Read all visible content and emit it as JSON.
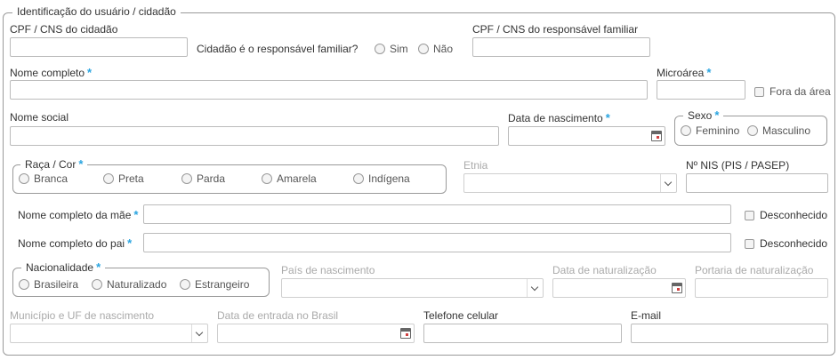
{
  "section": {
    "title": "Identificação do usuário / cidadão"
  },
  "cpf": {
    "label": "CPF / CNS do cidadão",
    "value": ""
  },
  "responsavel": {
    "question": "Cidadão é o responsável familiar?",
    "options": [
      "Sim",
      "Não"
    ]
  },
  "cpf_responsavel": {
    "label": "CPF / CNS do responsável familiar",
    "value": ""
  },
  "nome": {
    "label": "Nome completo",
    "required": "*",
    "value": ""
  },
  "microarea": {
    "label": "Microárea",
    "required": "*",
    "value": "",
    "fora_label": "Fora da área"
  },
  "nome_social": {
    "label": "Nome social",
    "value": ""
  },
  "nascimento": {
    "label": "Data de nascimento",
    "required": "*",
    "value": ""
  },
  "sexo": {
    "legend": "Sexo",
    "required": "*",
    "options": [
      "Feminino",
      "Masculino"
    ]
  },
  "raca": {
    "legend": "Raça / Cor",
    "required": "*",
    "options": [
      "Branca",
      "Preta",
      "Parda",
      "Amarela",
      "Indígena"
    ]
  },
  "etnia": {
    "label": "Etnia",
    "value": ""
  },
  "nis": {
    "label": "Nº NIS (PIS / PASEP)",
    "value": ""
  },
  "mae": {
    "label": "Nome completo da mãe",
    "required": "*",
    "value": "",
    "unknown_label": "Desconhecido"
  },
  "pai": {
    "label": "Nome completo do pai",
    "required": "*",
    "value": "",
    "unknown_label": "Desconhecido"
  },
  "nacionalidade": {
    "legend": "Nacionalidade",
    "required": "*",
    "options": [
      "Brasileira",
      "Naturalizado",
      "Estrangeiro"
    ]
  },
  "pais_nascimento": {
    "label": "País de nascimento",
    "value": ""
  },
  "data_naturalizacao": {
    "label": "Data de naturalização",
    "value": ""
  },
  "portaria": {
    "label": "Portaria de naturalização",
    "value": ""
  },
  "municipio": {
    "label": "Município e UF de nascimento",
    "value": ""
  },
  "data_entrada": {
    "label": "Data de entrada no Brasil",
    "value": ""
  },
  "telefone": {
    "label": "Telefone celular",
    "value": ""
  },
  "email": {
    "label": "E-mail",
    "value": ""
  }
}
